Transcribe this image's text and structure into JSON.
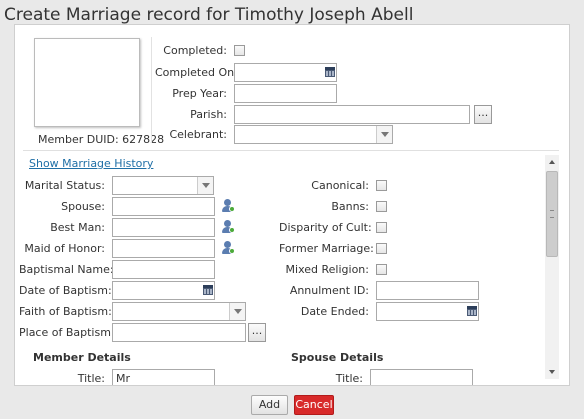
{
  "dialog": {
    "title": "Create Marriage record for Timothy Joseph Abell"
  },
  "header_form": {
    "member_duid": "Member DUID: 627828",
    "completed_label": "Completed:",
    "completed_on_label": "Completed On:",
    "prep_year_label": "Prep Year:",
    "parish_label": "Parish:",
    "celebrant_label": "Celebrant:",
    "parish_button": "..."
  },
  "history_link": "Show Marriage History",
  "left_form": {
    "marital_status_label": "Marital Status:",
    "spouse_label": "Spouse:",
    "best_man_label": "Best Man:",
    "maid_of_honor_label": "Maid of Honor:",
    "baptismal_name_label": "Baptismal Name:",
    "date_of_baptism_label": "Date of Baptism:",
    "faith_of_baptism_label": "Faith of Baptism:",
    "place_of_baptism_label": "Place of Baptism:",
    "place_button": "..."
  },
  "right_form": {
    "canonical_label": "Canonical:",
    "banns_label": "Banns:",
    "disparity_label": "Disparity of Cult:",
    "former_marriage_label": "Former Marriage:",
    "mixed_religion_label": "Mixed Religion:",
    "annulment_id_label": "Annulment ID:",
    "date_ended_label": "Date Ended:"
  },
  "sections": {
    "member_details": "Member Details",
    "spouse_details": "Spouse Details",
    "member_title_label": "Title:",
    "member_title_value": "Mr",
    "spouse_title_label": "Title:"
  },
  "footer": {
    "add_label": "Add",
    "cancel_label": "Cancel"
  },
  "colors": {
    "cancel": "#d82a2a",
    "link": "#1f6fa6",
    "icon_person": "#5b7db0"
  }
}
